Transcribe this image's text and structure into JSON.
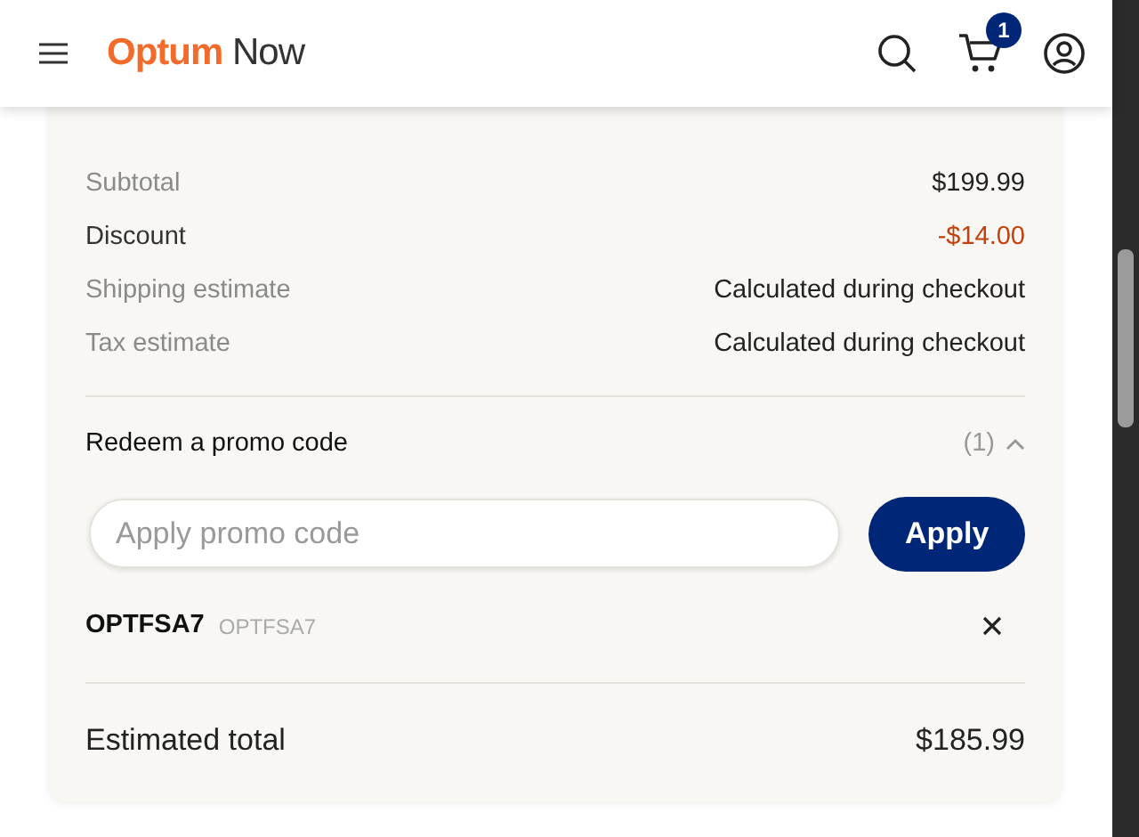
{
  "header": {
    "logo": {
      "brand": "Optum",
      "product": "Now"
    },
    "cart_count": "1"
  },
  "summary": {
    "rows": [
      {
        "label": "Subtotal",
        "value": "$199.99",
        "kind": "muted"
      },
      {
        "label": "Discount",
        "value": "-$14.00",
        "kind": "discount"
      },
      {
        "label": "Shipping estimate",
        "value": "Calculated during checkout",
        "kind": "muted"
      },
      {
        "label": "Tax estimate",
        "value": "Calculated during checkout",
        "kind": "muted"
      }
    ],
    "promo": {
      "title": "Redeem a promo code",
      "count": "(1)",
      "expanded": true,
      "placeholder": "Apply promo code",
      "button": "Apply",
      "applied": [
        {
          "code": "OPTFSA7",
          "detail": "OPTFSA7"
        }
      ]
    },
    "total": {
      "label": "Estimated total",
      "value": "$185.99"
    }
  }
}
